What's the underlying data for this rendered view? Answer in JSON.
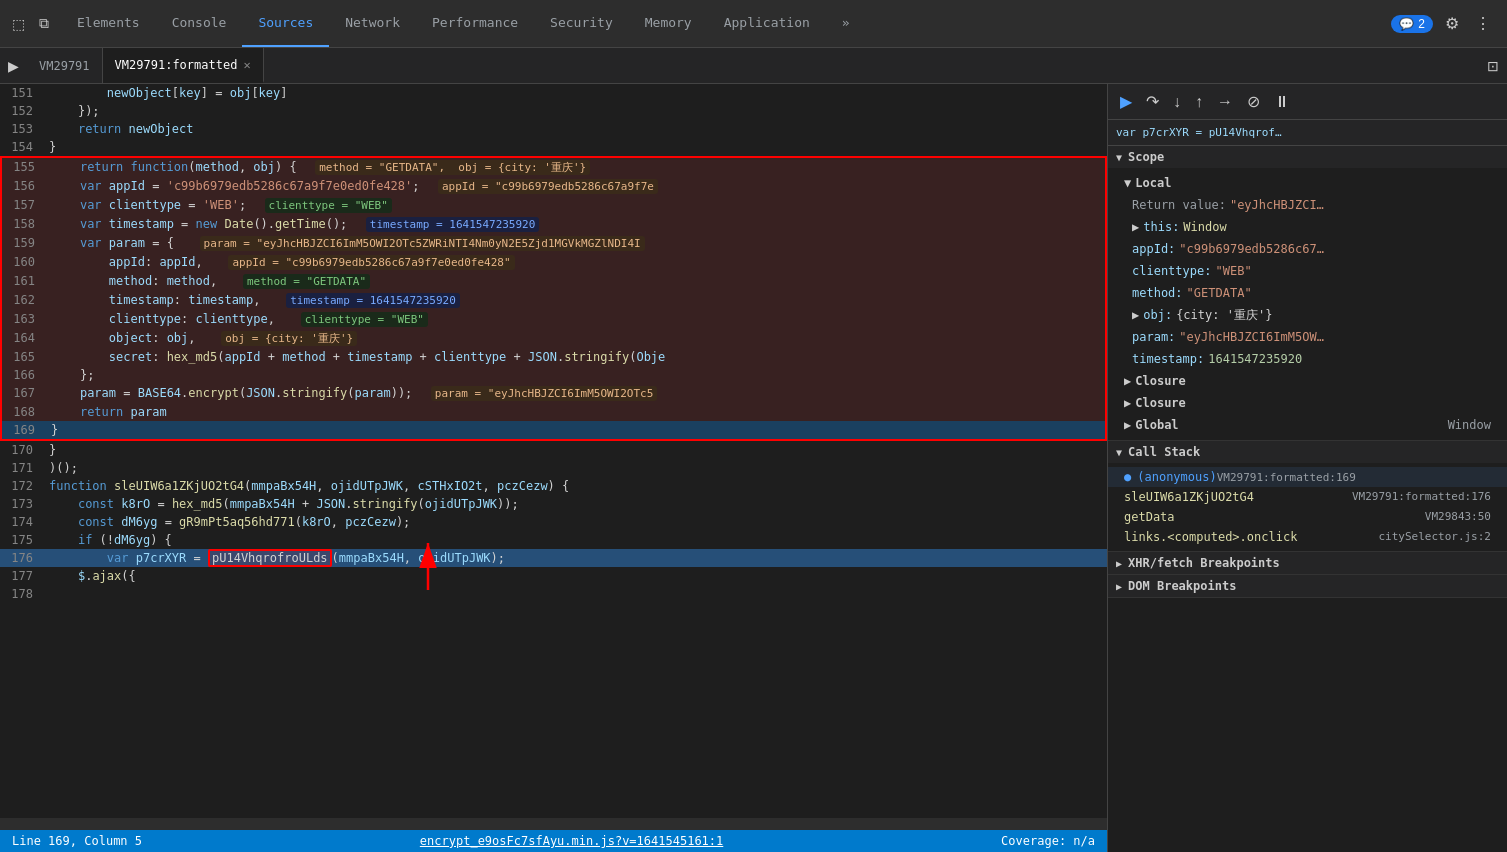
{
  "tabs": {
    "items": [
      {
        "label": "Elements",
        "active": false
      },
      {
        "label": "Console",
        "active": false
      },
      {
        "label": "Sources",
        "active": true
      },
      {
        "label": "Network",
        "active": false
      },
      {
        "label": "Performance",
        "active": false
      },
      {
        "label": "Security",
        "active": false
      },
      {
        "label": "Memory",
        "active": false
      },
      {
        "label": "Application",
        "active": false
      }
    ],
    "more_label": "»",
    "badge_count": "2"
  },
  "file_tabs": {
    "items": [
      {
        "label": "VM29791",
        "active": false,
        "closable": false
      },
      {
        "label": "VM29791:formatted",
        "active": true,
        "closable": true
      }
    ]
  },
  "debug_controls": {
    "resume": "▶",
    "step_over": "↷",
    "step_into": "↓",
    "step_out": "↑",
    "step": "→",
    "deactivate": "⊘",
    "pause": "⏸"
  },
  "right_panel": {
    "var_line": "var p7crXYR = pU14Vhqrof…",
    "scope_label": "Scope",
    "local_label": "Local",
    "return_value_key": "Return value:",
    "return_value": "\"eyJhcHBJZCI…",
    "this_key": "this:",
    "this_value": "Window",
    "appId_key": "appId:",
    "appId_value": "\"c99b6979edb5286c67…",
    "clienttype_key": "clienttype:",
    "clienttype_value": "\"WEB\"",
    "method_key": "method:",
    "method_value": "\"GETDATA\"",
    "obj_key": "obj:",
    "obj_value": "{city: '重庆'}",
    "param_key": "param:",
    "param_value": "\"eyJhcHBJZCI6ImM5OW…",
    "timestamp_key": "timestamp:",
    "timestamp_value": "1641547235920",
    "closure_label": "Closure",
    "closure_label2": "Closure",
    "global_label": "Global",
    "global_value": "Window",
    "call_stack_label": "Call Stack",
    "call_stack": [
      {
        "name": "(anonymous)",
        "location": "VM29791:formatted:169",
        "active": true
      },
      {
        "name": "sleUIW6a1ZKjUO2tG4",
        "location": "VM29791:formatted:176",
        "active": false
      },
      {
        "name": "getData",
        "location": "VM29843:50",
        "active": false
      },
      {
        "name": "links.<computed>.onclick",
        "location": "citySelector.js:2",
        "active": false
      }
    ],
    "xhr_label": "XHR/fetch Breakpoints",
    "dom_label": "DOM Breakpoints"
  },
  "code_lines": [
    {
      "n": 151,
      "content": "        newObject[key] = obj[key]"
    },
    {
      "n": 152,
      "content": "    });"
    },
    {
      "n": 153,
      "content": "    return newObject"
    },
    {
      "n": 154,
      "content": "}"
    },
    {
      "n": 155,
      "content": "    return function(method, obj) {  method = \"GETDATA\",  obj = {city: '重庆'}"
    },
    {
      "n": 156,
      "content": "    var appId = 'c99b6979edb5286c67a9f7e0ed0fe428';  appId = \"c99b6979edb5286c67a9f7e"
    },
    {
      "n": 157,
      "content": "    var clienttype = 'WEB';  clienttype = \"WEB\""
    },
    {
      "n": 158,
      "content": "    var timestamp = new Date().getTime();  timestamp = 1641547235920"
    },
    {
      "n": 159,
      "content": "    var param = {   param = \"eyJhcHBJZCI6ImM5OWI2OTc5ZWRiNTI4Nm0yN2E5Zjd1MGVkMGZlNDI4I"
    },
    {
      "n": 160,
      "content": "        appId: appId,   appId = \"c99b6979edb5286c67a9f7e0ed0fe428\""
    },
    {
      "n": 161,
      "content": "        method: method,   method = \"GETDATA\""
    },
    {
      "n": 162,
      "content": "        timestamp: timestamp,   timestamp = 1641547235920"
    },
    {
      "n": 163,
      "content": "        clienttype: clienttype,   clienttype = \"WEB\""
    },
    {
      "n": 164,
      "content": "        object: obj,   obj = {city: '重庆'}"
    },
    {
      "n": 165,
      "content": "        secret: hex_md5(appId + method + timestamp + clienttype + JSON.stringify(Obje"
    },
    {
      "n": 166,
      "content": "    };"
    },
    {
      "n": 167,
      "content": "    param = BASE64.encrypt(JSON.stringify(param));  param = \"eyJhcHBJZCI6ImM5OWI2OTc5"
    },
    {
      "n": 168,
      "content": "    return param"
    },
    {
      "n": 169,
      "content": "}"
    },
    {
      "n": 170,
      "content": "}"
    },
    {
      "n": 171,
      "content": ")();"
    },
    {
      "n": 172,
      "content": "function sleUIW6a1ZKjUO2tG4(mmpaBx54H, ojidUTpJWK, cSTHxIO2t, pczCezw) {"
    },
    {
      "n": 173,
      "content": "    const k8rO = hex_md5(mmpaBx54H + JSON.stringify(ojidUTpJWK));"
    },
    {
      "n": 174,
      "content": "    const dM6yg = gR9mPt5aq56hd771(k8rO, pczCezw);"
    },
    {
      "n": 175,
      "content": "    if (!dM6yg) {"
    },
    {
      "n": 176,
      "content": "        var p7crXYR = pU14VhqrofroULds(mmpaBx54H, ojidUTpJWK);"
    },
    {
      "n": 177,
      "content": "    $.ajax({"
    },
    {
      "n": 178,
      "content": ""
    }
  ],
  "status_bar": {
    "left": "Line 169, Column 5",
    "center": "encrypt_e9osFc7sfAyu.min.js?v=1641545161:1",
    "right": "Coverage: n/a"
  }
}
